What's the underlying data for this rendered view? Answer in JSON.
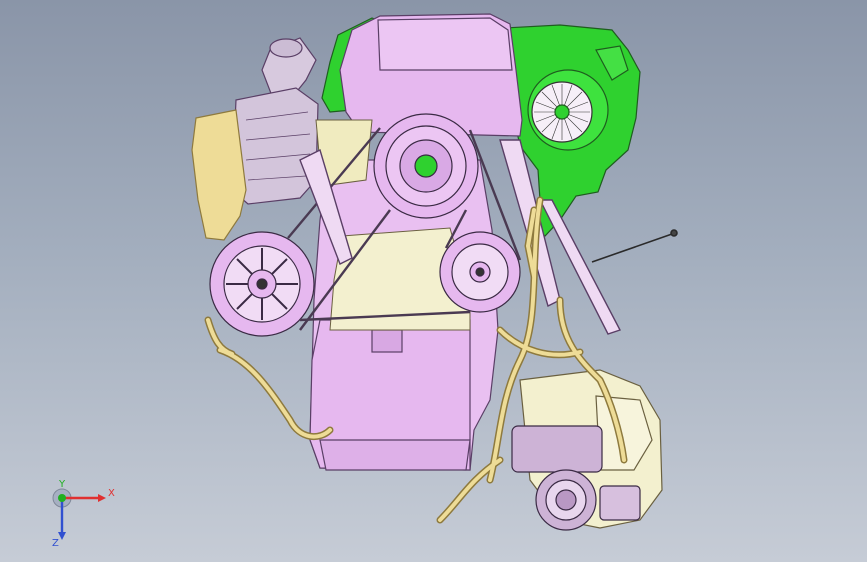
{
  "viewport": {
    "name": "cad-3d-viewport",
    "background_top": "#8a95a8",
    "background_bottom": "#c6ccd6"
  },
  "model": {
    "colors": {
      "engine_block": "#e6b8ef",
      "engine_edge": "#5a3f66",
      "transmission": "#2fd12f",
      "transmission_edge": "#1f5d1f",
      "harness": "#eedc97",
      "harness_edge": "#8e7a3e",
      "metal_gray": "#cfc3d6",
      "intake_pale": "#f3f0cf"
    }
  },
  "triad": {
    "x_label": "X",
    "y_label": "Y",
    "z_label": "Z",
    "x_color": "#e03030",
    "y_color": "#20b020",
    "z_color": "#3050d0"
  }
}
